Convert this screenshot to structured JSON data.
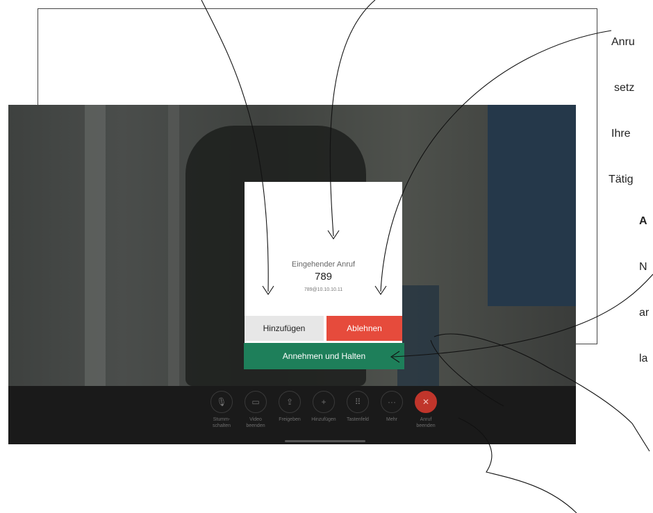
{
  "callouts": {
    "top_right_lines": [
      "Anru",
      "setz",
      "Ihre",
      "Tätig"
    ],
    "right_heading": "A",
    "right_lines": [
      "N",
      "ar",
      "la"
    ]
  },
  "dialog": {
    "title": "Eingehender Anruf",
    "number": "789",
    "address": "789@10.10.10.11",
    "add_label": "Hinzufügen",
    "decline_label": "Ablehnen",
    "accept_hold_label": "Annehmen und Halten"
  },
  "toolbar": {
    "items": [
      {
        "label": "Stumm-\nschalten",
        "icon": "microphone-icon"
      },
      {
        "label": "Video\nbeenden",
        "icon": "camera-icon"
      },
      {
        "label": "Freigeben",
        "icon": "share-icon"
      },
      {
        "label": "Hinzufügen",
        "icon": "plus-icon"
      },
      {
        "label": "Tastenfeld",
        "icon": "keypad-icon"
      },
      {
        "label": "Mehr",
        "icon": "more-icon"
      },
      {
        "label": "Anruf\nbeenden",
        "icon": "end-call-icon"
      }
    ]
  },
  "colors": {
    "accept": "#1e7f5a",
    "decline": "#e64b3c",
    "end_call": "#c0352b"
  }
}
